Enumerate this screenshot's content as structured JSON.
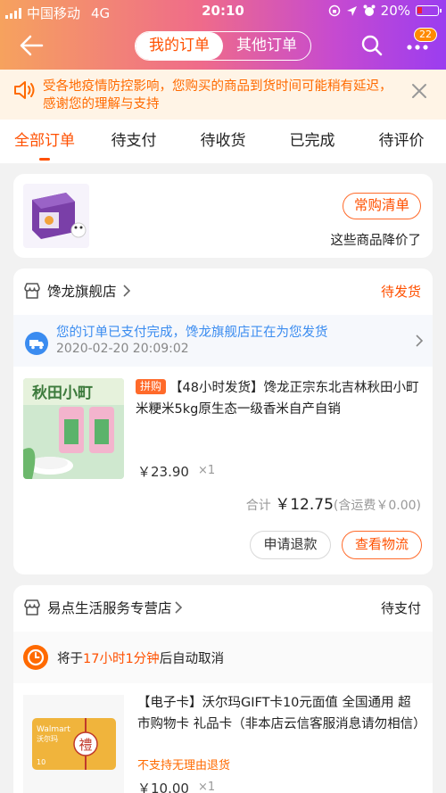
{
  "status_bar": {
    "carrier": "中国移动",
    "network": "4G",
    "time": "20:10",
    "battery": "20%"
  },
  "header": {
    "tab_mine": "我的订单",
    "tab_other": "其他订单",
    "more_badge": "22"
  },
  "notice": {
    "text": "受各地疫情防控影响，您购买的商品到货时间可能稍有延迟，感谢您的理解与支持"
  },
  "tabs": [
    "全部订单",
    "待支付",
    "待收货",
    "已完成",
    "待评价"
  ],
  "promo_card": {
    "button": "常购清单",
    "subtitle": "这些商品降价了"
  },
  "order1": {
    "shop": "馋龙旗舰店",
    "status": "待发货",
    "ship_msg": "您的订单已支付完成，馋龙旗舰店正在为您发货",
    "ship_time": "2020-02-20 20:09:02",
    "tag": "拼购",
    "title": "【48小时发货】馋龙正宗东北吉林秋田小町米粳米5kg原生态一级香米自产自销",
    "image_text": "秋田小町",
    "price": "￥23.90",
    "qty": "×1",
    "total_label": "合计",
    "total": "￥12.75",
    "shipping": "(含运费￥0.00)",
    "btn_refund": "申请退款",
    "btn_logistics": "查看物流"
  },
  "order2": {
    "shop": "易点生活服务专营店",
    "status": "待支付",
    "timer_prefix": "将于",
    "timer_value": "17小时1分钟",
    "timer_suffix": "后自动取消",
    "title": "【电子卡】沃尔玛GIFT卡10元面值 全国通用 超市购物卡 礼品卡（非本店云信客服消息请勿相信）",
    "no_return": "不支持无理由退货",
    "price": "￥10.00",
    "qty": "×1",
    "card_brand": "Walmart",
    "card_brand_cn": "沃尔玛",
    "card_value": "10",
    "card_char": "禮"
  }
}
